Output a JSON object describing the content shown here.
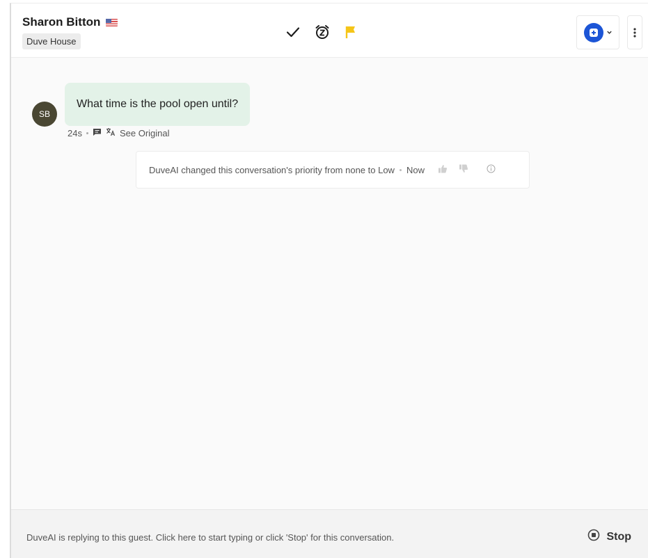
{
  "header": {
    "guest_name": "Sharon Bitton",
    "country_flag": "us-flag-icon",
    "property": "Duve House",
    "actions": [
      {
        "name": "resolve-check-icon",
        "label": "check"
      },
      {
        "name": "snooze-alarm-icon",
        "label": "snooze"
      },
      {
        "name": "priority-flag-icon",
        "label": "flag",
        "color": "#f5c518"
      }
    ],
    "assign_color": "#1c55d6"
  },
  "message": {
    "avatar_initials": "SB",
    "text": "What time is the pool open until?",
    "time": "24s",
    "see_original": "See Original",
    "bubble_color": "#e3f2e8"
  },
  "system_note": {
    "text": "DuveAI changed this conversation's priority from none to Low",
    "time": "Now"
  },
  "footer": {
    "status_text": "DuveAI is replying to this guest. Click here to start typing or click 'Stop' for this conversation.",
    "stop_label": "Stop"
  }
}
